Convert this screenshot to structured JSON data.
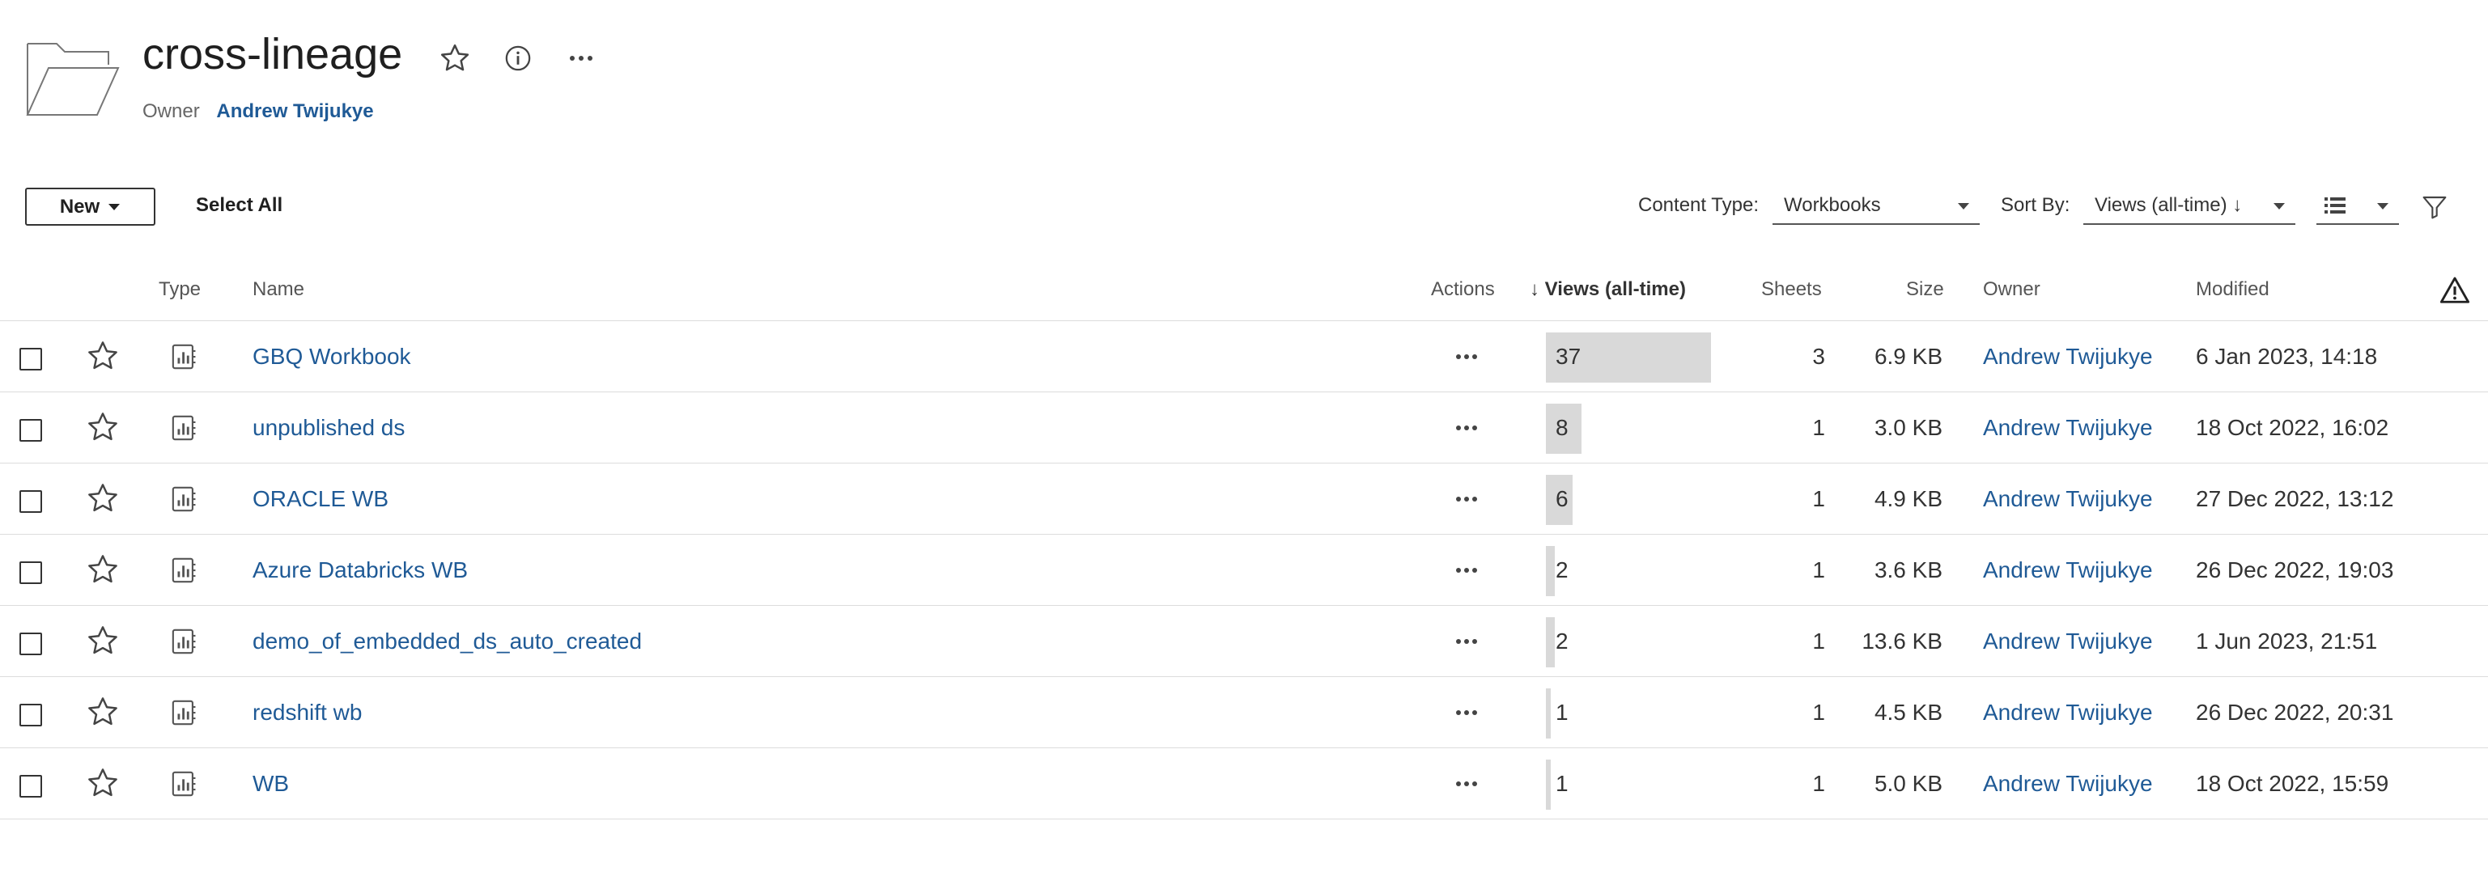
{
  "header": {
    "title": "cross-lineage",
    "owner_label": "Owner",
    "owner_name": "Andrew Twijukye"
  },
  "toolbar": {
    "new_label": "New",
    "select_all_label": "Select All",
    "content_type_label": "Content Type:",
    "content_type_value": "Workbooks",
    "sort_by_label": "Sort By:",
    "sort_by_value": "Views (all-time) ↓"
  },
  "table": {
    "columns": {
      "type": "Type",
      "name": "Name",
      "actions": "Actions",
      "views": "↓ Views (all-time)",
      "sheets": "Sheets",
      "size": "Size",
      "owner": "Owner",
      "modified": "Modified"
    },
    "max_views": 37,
    "rows": [
      {
        "name": "GBQ Workbook",
        "views": 37,
        "views_label": "37",
        "sheets": "3",
        "size": "6.9 KB",
        "owner": "Andrew Twijukye",
        "modified": "6 Jan 2023, 14:18"
      },
      {
        "name": "unpublished ds",
        "views": 8,
        "views_label": "8",
        "sheets": "1",
        "size": "3.0 KB",
        "owner": "Andrew Twijukye",
        "modified": "18 Oct 2022, 16:02"
      },
      {
        "name": "ORACLE WB",
        "views": 6,
        "views_label": "6",
        "sheets": "1",
        "size": "4.9 KB",
        "owner": "Andrew Twijukye",
        "modified": "27 Dec 2022, 13:12"
      },
      {
        "name": "Azure Databricks WB",
        "views": 2,
        "views_label": "2",
        "sheets": "1",
        "size": "3.6 KB",
        "owner": "Andrew Twijukye",
        "modified": "26 Dec 2022, 19:03"
      },
      {
        "name": "demo_of_embedded_ds_auto_created",
        "views": 2,
        "views_label": "2",
        "sheets": "1",
        "size": "13.6 KB",
        "owner": "Andrew Twijukye",
        "modified": "1 Jun 2023, 21:51"
      },
      {
        "name": "redshift wb",
        "views": 1,
        "views_label": "1",
        "sheets": "1",
        "size": "4.5 KB",
        "owner": "Andrew Twijukye",
        "modified": "26 Dec 2022, 20:31"
      },
      {
        "name": "WB",
        "views": 1,
        "views_label": "1",
        "sheets": "1",
        "size": "5.0 KB",
        "owner": "Andrew Twijukye",
        "modified": "18 Oct 2022, 15:59"
      }
    ]
  },
  "icons": {
    "folder": "folder-icon",
    "favorite": "star-icon",
    "info": "info-icon",
    "more": "more-icon",
    "list_view": "list-view-icon",
    "filter": "filter-icon",
    "warning": "warning-icon",
    "workbook": "workbook-icon"
  },
  "colors": {
    "link": "#1f5a96",
    "bar": "#d9d9d9",
    "divider": "#dcdcdc"
  }
}
